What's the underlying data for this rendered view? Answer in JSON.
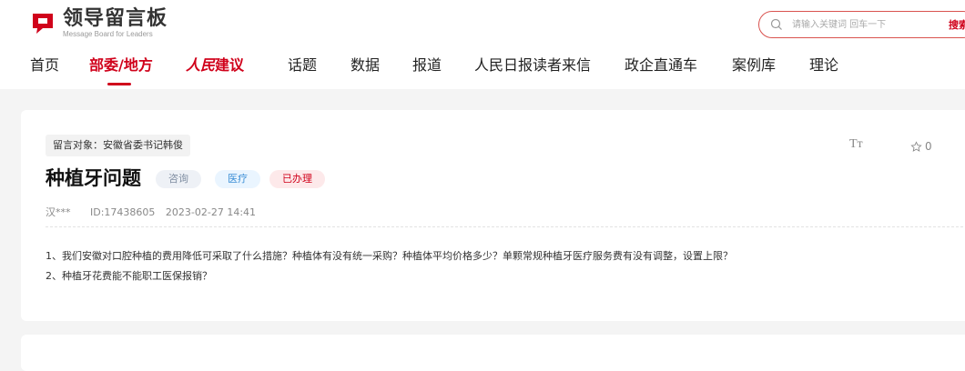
{
  "brand": {
    "name_cn": "领导留言板",
    "name_en": "Message Board for Leaders",
    "color": "#d0021b"
  },
  "search": {
    "placeholder": "请输入关键词 回车一下",
    "button_label": "搜索"
  },
  "nav": {
    "items": [
      {
        "label": "首页"
      },
      {
        "label": "部委/地方",
        "active": true
      },
      {
        "label_a": "人民",
        "label_b": "建议"
      },
      {
        "label": "话题"
      },
      {
        "label": "数据"
      },
      {
        "label": "报道"
      },
      {
        "label": "人民日报读者来信"
      },
      {
        "label": "政企直通车"
      },
      {
        "label": "案例库"
      },
      {
        "label": "理论"
      }
    ]
  },
  "message": {
    "target": "留言对象：安徽省委书记韩俊",
    "title": "种植牙问题",
    "tags": [
      "咨询",
      "医疗",
      "已办理"
    ],
    "author": "汉***",
    "id": "ID:17438605",
    "datetime": "2023-02-27 14:41",
    "font_size_icon": "Tт",
    "favorite_count": "0",
    "content": [
      "1、我们安徽对口腔种植的费用降低可采取了什么措施？种植体有没有统一采购？种植体平均价格多少？单颗常规种植牙医疗服务费有没有调整，设置上限？",
      "2、种植牙花费能不能职工医保报销？"
    ]
  }
}
